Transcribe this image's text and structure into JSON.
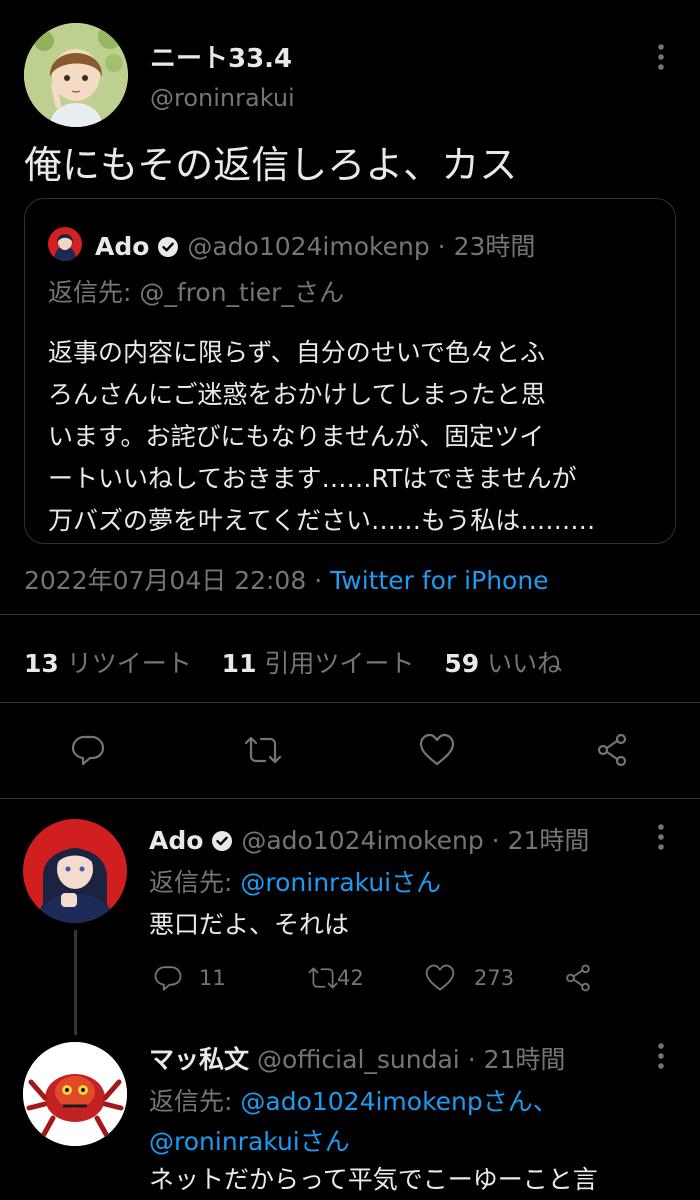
{
  "main_tweet": {
    "display_name": "ニート33.4",
    "handle": "@roninrakui",
    "text": "俺にもその返信しろよ、カス",
    "quoted": {
      "name": "Ado",
      "handle": "@ado1024imokenp",
      "sep": "·",
      "time": "23時間",
      "reply_to_prefix": "返信先: ",
      "reply_to_handle": "@_fron_tier_",
      "reply_to_suffix": "さん",
      "body_lines": [
        "返事の内容に限らず、自分のせいで色々とふ",
        "ろんさんにご迷惑をおかけしてしまったと思",
        "います。お詫びにもなりませんが、固定ツイ",
        "ートいいねしておきます……RTはできませんが",
        "万バズの夢を叶えてください……もう私は………"
      ]
    },
    "timestamp": "2022年07月04日 22:08",
    "sep": "·",
    "client": "Twitter for iPhone",
    "stats": {
      "retweets_count": "13",
      "retweets_label": "リツイート",
      "quotes_count": "11",
      "quotes_label": "引用ツイート",
      "likes_count": "59",
      "likes_label": "いいね"
    }
  },
  "replies": [
    {
      "name": "Ado",
      "handle": "@ado1024imokenp",
      "sep": "·",
      "time": "21時間",
      "reply_prefix": "返信先: ",
      "reply_handle_1": "@roninrakui",
      "reply_suffix_1": "さん",
      "text": "悪口だよ、それは",
      "reply_count": "11",
      "retweet_count": "42",
      "like_count": "273"
    },
    {
      "name": "マッ私文",
      "handle": "@official_sundai",
      "sep": "·",
      "time": "21時間",
      "reply_prefix": "返信先: ",
      "reply_handle_1": "@ado1024imokenp",
      "reply_suffix_1": "さん、",
      "reply_handle_2": "@roninrakui",
      "reply_suffix_2": "さん",
      "text": "ネットだからって平気でこーゆーこと言"
    }
  ],
  "icons": [
    "more-icon",
    "verified-icon",
    "reply-icon",
    "retweet-icon",
    "like-icon",
    "share-icon"
  ],
  "colors": {
    "background": "#000000",
    "text": "#e7e9ea",
    "secondary": "#71767b",
    "accent": "#1d9bf0",
    "divider": "#2f3336"
  }
}
